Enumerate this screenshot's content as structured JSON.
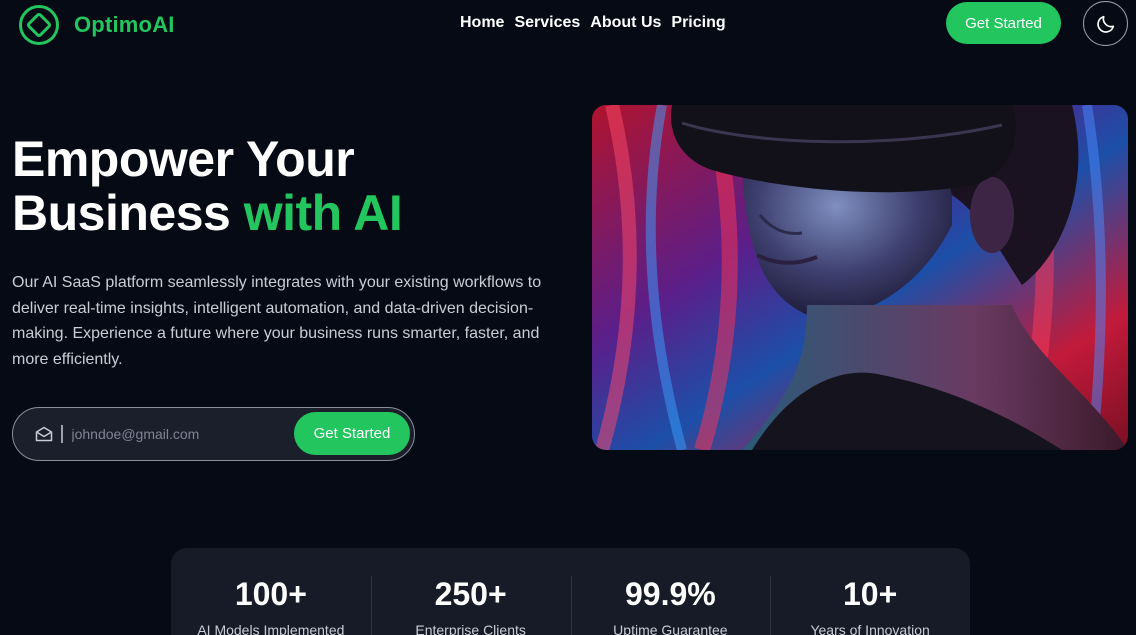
{
  "brand": {
    "name": "OptimoAI",
    "accent": "#22c55e"
  },
  "nav": {
    "links": [
      "Home",
      "Services",
      "About Us",
      "Pricing"
    ],
    "cta_label": "Get Started",
    "theme_icon": "moon-icon"
  },
  "hero": {
    "title_line1": "Empower Your",
    "title_line2_plain": "Business",
    "title_line2_accent": "with AI",
    "description": "Our AI SaaS platform seamlessly integrates with your existing workflows to deliver real-time insights, intelligent automation, and data-driven decision-making. Experience a future where your business runs smarter, faster, and more efficiently.",
    "email_placeholder": "johndoe@gmail.com",
    "form_cta_label": "Get Started",
    "image_icon": "vr-headset-person-image"
  },
  "stats": [
    {
      "value": "100+",
      "label": "AI Models Implemented"
    },
    {
      "value": "250+",
      "label": "Enterprise Clients"
    },
    {
      "value": "99.9%",
      "label": "Uptime Guarantee"
    },
    {
      "value": "10+",
      "label": "Years of Innovation"
    }
  ]
}
